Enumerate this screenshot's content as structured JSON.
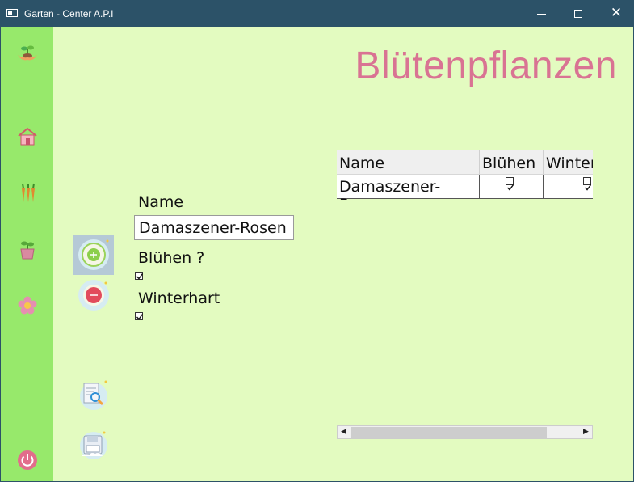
{
  "window": {
    "title": "Garten - Center A.P.I",
    "controls": {
      "minimize": "–",
      "maximize": "□",
      "close": "✕"
    }
  },
  "sidebar": {
    "items": [
      {
        "name": "logo-plant-hands-icon"
      },
      {
        "name": "home-icon"
      },
      {
        "name": "vegetables-icon"
      },
      {
        "name": "potted-plant-icon"
      },
      {
        "name": "flower-icon"
      },
      {
        "name": "power-icon"
      }
    ]
  },
  "page": {
    "heading": "Blütenpflanzen"
  },
  "form": {
    "name_label": "Name",
    "name_value": "Damaszener-Rosen",
    "bloom_label": "Blühen ?",
    "bloom_checked": true,
    "hardy_label": "Winterhart",
    "hardy_checked": true
  },
  "actions": [
    {
      "name": "add-icon"
    },
    {
      "name": "remove-icon"
    },
    {
      "name": "search-document-icon"
    },
    {
      "name": "save-icon"
    }
  ],
  "table": {
    "columns": [
      "Name",
      "Blühen",
      "Winter"
    ],
    "rows": [
      {
        "name": "Damaszener-Rosen",
        "bloom": true,
        "hardy": true
      }
    ]
  },
  "colors": {
    "titlebar": "#2c5268",
    "sidebar": "#97e96b",
    "background": "#e3fbc0",
    "heading": "#d97393"
  }
}
